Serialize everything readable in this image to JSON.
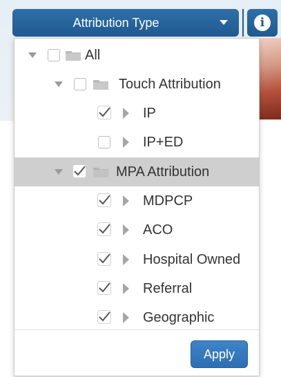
{
  "header": {
    "dropdown_label": "Attribution Type",
    "info_glyph": "i",
    "accent_color": "#2563a0"
  },
  "tree": {
    "root": {
      "label": "All",
      "checked": false,
      "expanded": true
    },
    "groups": [
      {
        "label": "Touch Attribution",
        "checked": false,
        "expanded": true,
        "items": [
          {
            "label": "IP",
            "checked": true
          },
          {
            "label": "IP+ED",
            "checked": false
          }
        ]
      },
      {
        "label": "MPA Attribution",
        "checked": true,
        "expanded": true,
        "highlighted": true,
        "items": [
          {
            "label": "MDPCP",
            "checked": true
          },
          {
            "label": "ACO",
            "checked": true
          },
          {
            "label": "Hospital Owned",
            "checked": true
          },
          {
            "label": "Referral",
            "checked": true
          },
          {
            "label": "Geographic",
            "checked": true
          }
        ]
      }
    ]
  },
  "footer": {
    "apply_label": "Apply"
  },
  "icons": {
    "expand": "caret-down-icon",
    "collapsed_leaf": "caret-right-icon",
    "folder": "folder-icon",
    "check": "checkmark-icon",
    "info": "info-icon"
  }
}
